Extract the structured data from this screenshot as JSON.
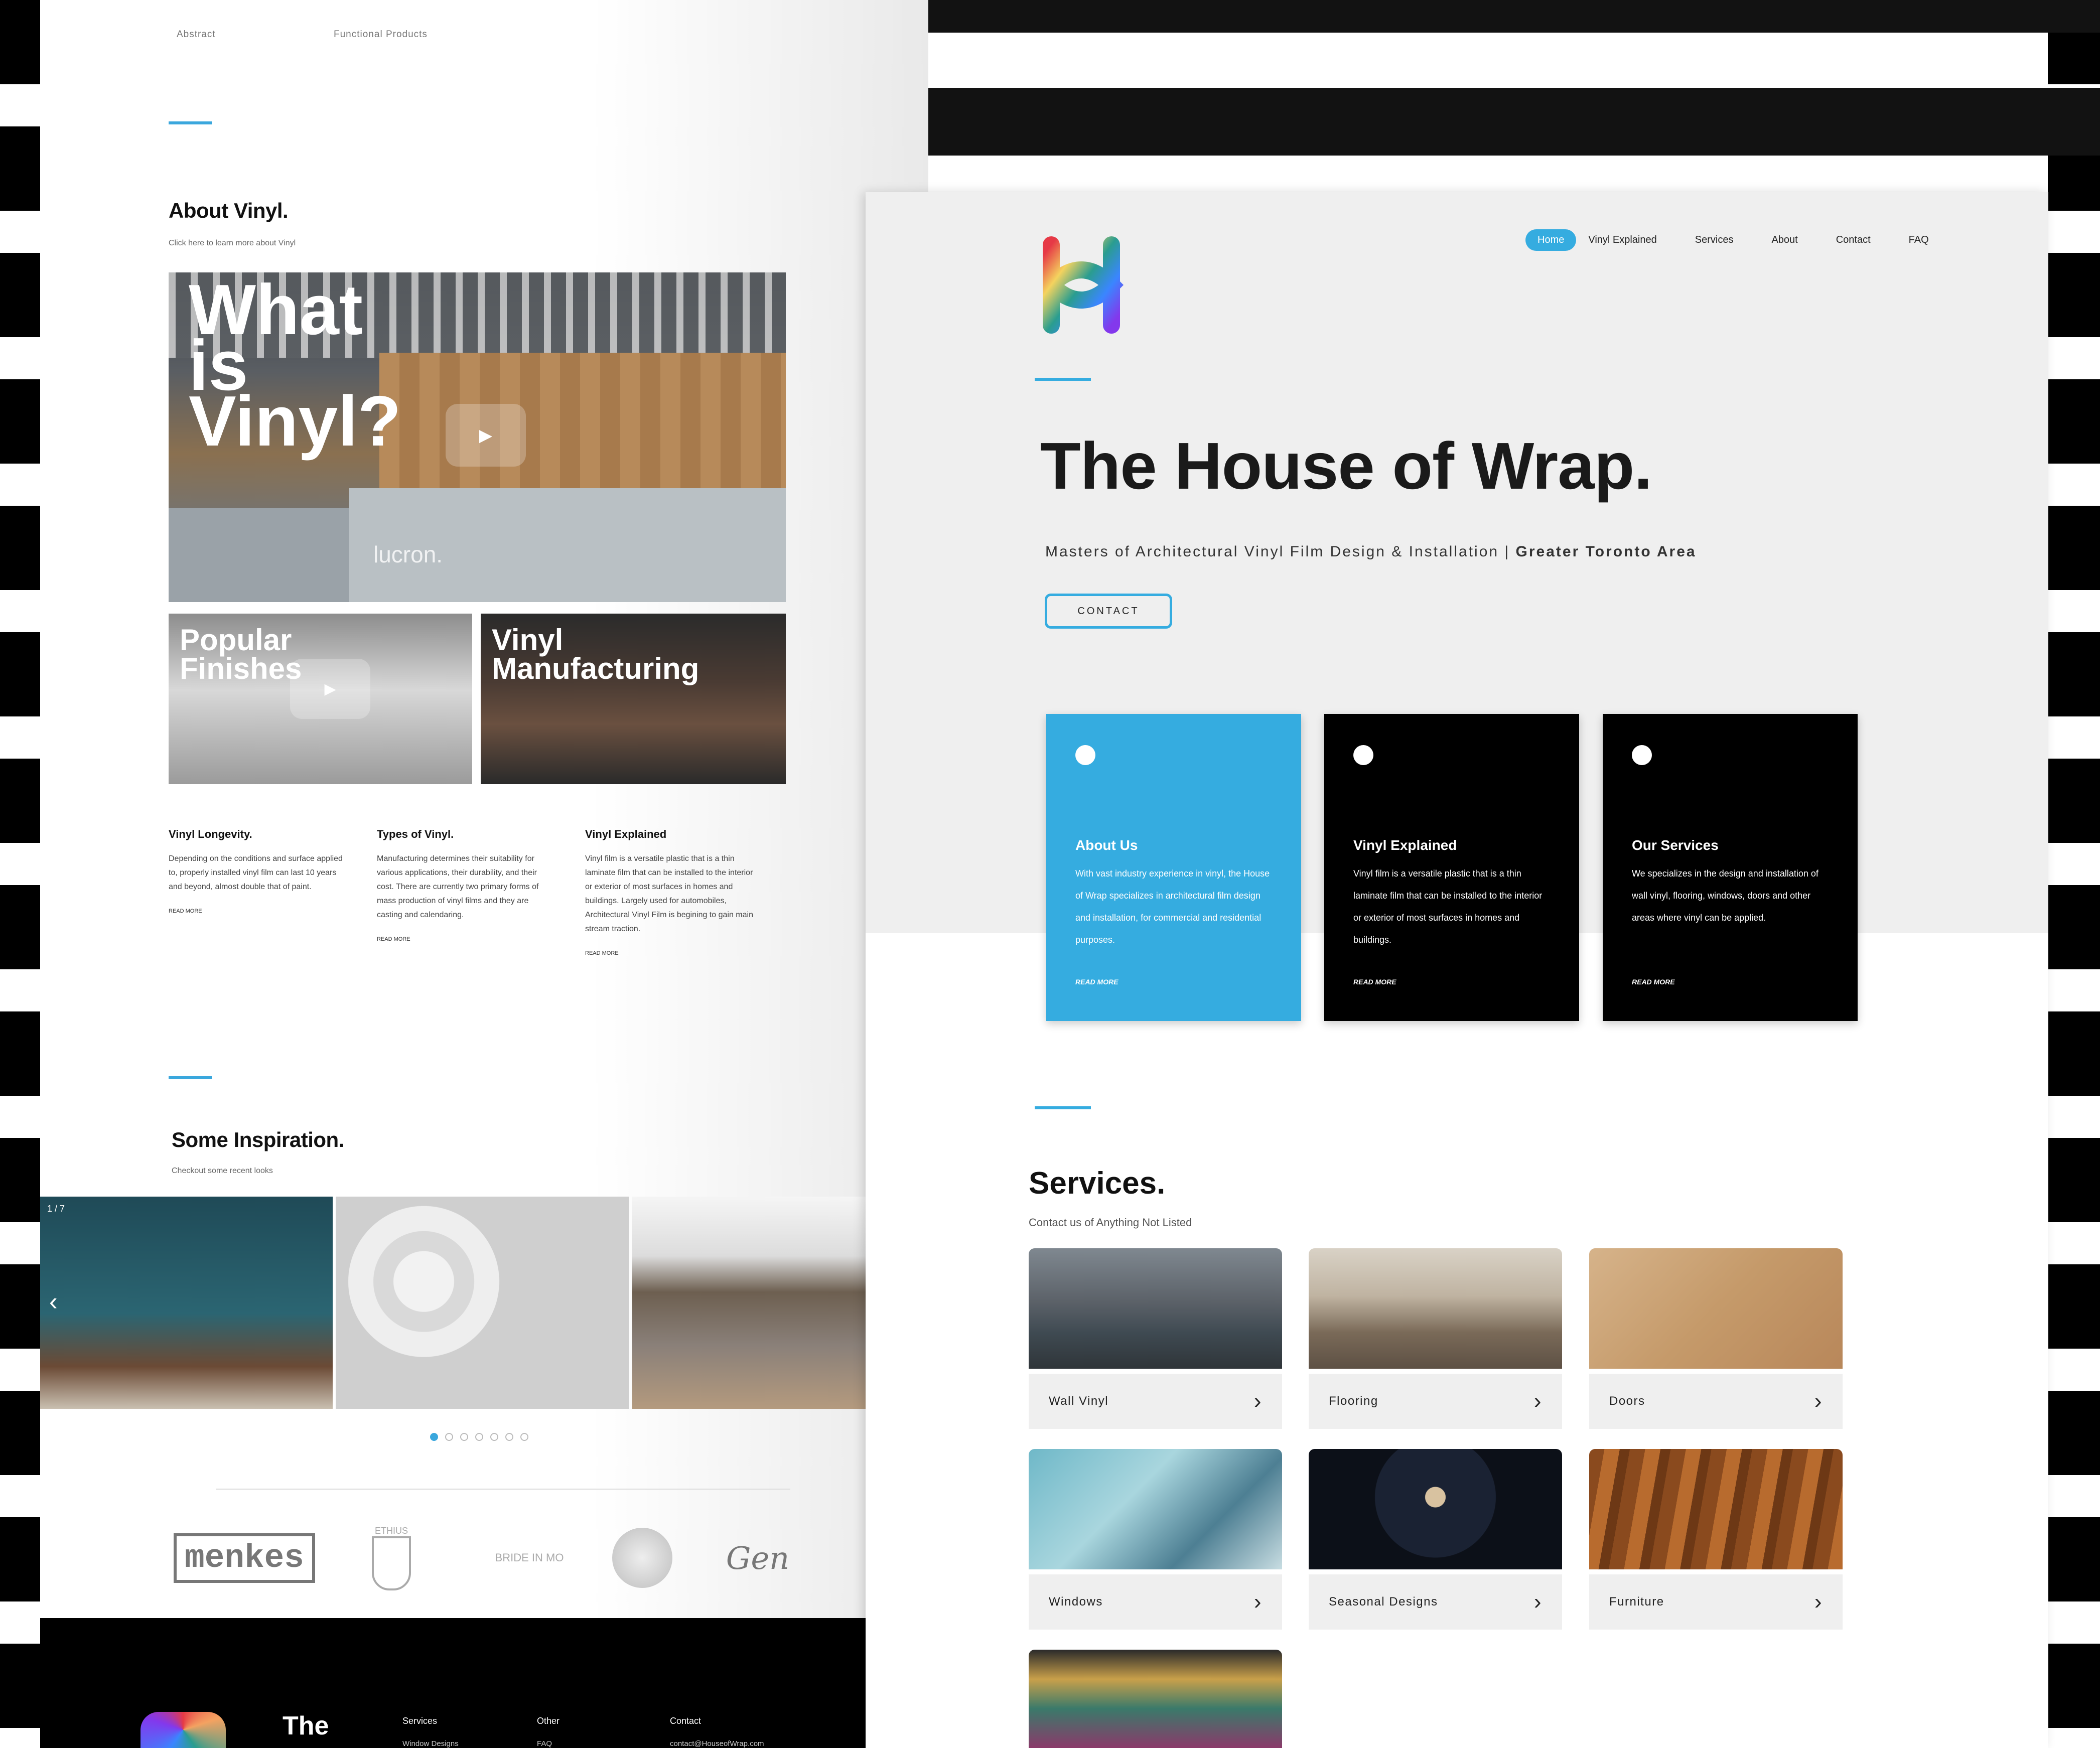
{
  "left_page": {
    "top_labels": [
      "Abstract",
      "Functional Products"
    ],
    "about": {
      "title": "About Vinyl.",
      "subtitle": "Click here to learn more about Vinyl"
    },
    "hero_tile": {
      "title": "What is Vinyl?",
      "brand": "lucron."
    },
    "tiles": [
      {
        "title": "Popular Finishes"
      },
      {
        "title": "Vinyl Manufacturing"
      }
    ],
    "info": [
      {
        "heading": "Vinyl Longevity.",
        "body": "Depending on the conditions and surface applied to, properly installed vinyl film can last 10 years and beyond, almost double that of paint.",
        "read_more": "READ MORE"
      },
      {
        "heading": "Types of Vinyl.",
        "body": "Manufacturing determines their suitability for various applications, their durability, and their cost. There are currently two primary forms of mass production of vinyl films and they are casting and calendaring.",
        "read_more": "READ MORE"
      },
      {
        "heading": "Vinyl Explained",
        "body": "Vinyl film is a versatile plastic that is a thin laminate film that can be installed to the interior or exterior of most surfaces in homes and buildings. Largely used for automobiles, Architectural Vinyl Film is begining to gain main stream traction.",
        "read_more": "READ MORE"
      }
    ],
    "inspiration": {
      "title": "Some Inspiration.",
      "subtitle": "Checkout some recent looks",
      "counter": "1 / 7",
      "dots": 7,
      "active_dot": 0
    },
    "partner_logos": [
      "menkes",
      "ETHIUS",
      "BRIDE IN MO",
      "",
      "Gen"
    ],
    "footer": {
      "brand": "The",
      "columns": [
        {
          "title": "Services",
          "item": "Window Designs"
        },
        {
          "title": "Other",
          "item": "FAQ"
        },
        {
          "title": "Contact",
          "item": "contact@HouseofWrap.com"
        }
      ]
    }
  },
  "right_page": {
    "nav": [
      "Home",
      "Vinyl Explained",
      "Services",
      "About",
      "Contact",
      "FAQ"
    ],
    "active_nav": "Home",
    "hero": {
      "title": "The House of Wrap.",
      "subtitle_main": "Masters of Architectural Vinyl Film Design & Installation | ",
      "subtitle_bold": "Greater Toronto Area",
      "cta": "CONTACT"
    },
    "cards": [
      {
        "title": "About Us",
        "body": "With vast industry experience in vinyl, the House of Wrap specializes in architectural film design and installation, for commercial and residential purposes.",
        "read_more": "READ MORE",
        "color": "#35ace0"
      },
      {
        "title": "Vinyl Explained",
        "body": "Vinyl film is a versatile plastic that is a thin laminate film that can be installed to the interior or exterior of most surfaces in homes and buildings.",
        "read_more": "READ MORE",
        "color": "#000000"
      },
      {
        "title": "Our Services",
        "body": "We specializes in the design and installation of wall vinyl, flooring, windows, doors and other areas where vinyl can be applied.",
        "read_more": "READ MORE",
        "color": "#000000"
      }
    ],
    "services": {
      "title": "Services.",
      "subtitle": "Contact us of Anything Not Listed",
      "items": [
        {
          "label": "Wall Vinyl"
        },
        {
          "label": "Flooring"
        },
        {
          "label": "Doors"
        },
        {
          "label": "Windows"
        },
        {
          "label": "Seasonal Designs"
        },
        {
          "label": "Furniture"
        }
      ]
    }
  },
  "colors": {
    "accent": "#35ace0",
    "dark": "#000000",
    "light_gray": "#efefef"
  }
}
